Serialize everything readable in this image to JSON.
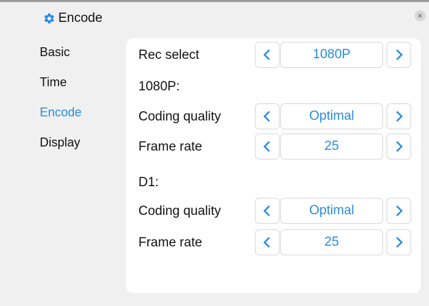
{
  "window": {
    "title": "Encode",
    "title_icon": "gear-icon",
    "close_glyph": "×"
  },
  "sidebar": {
    "items": [
      {
        "label": "Basic",
        "active": false
      },
      {
        "label": "Time",
        "active": false
      },
      {
        "label": "Encode",
        "active": true
      },
      {
        "label": "Display",
        "active": false
      }
    ]
  },
  "encode": {
    "rec_select": {
      "label": "Rec select",
      "value": "1080P"
    },
    "sections": [
      {
        "title": "1080P:",
        "coding_quality": {
          "label": "Coding quality",
          "value": "Optimal"
        },
        "frame_rate": {
          "label": "Frame rate",
          "value": "25"
        }
      },
      {
        "title": "D1:",
        "coding_quality": {
          "label": "Coding quality",
          "value": "Optimal"
        },
        "frame_rate": {
          "label": "Frame rate",
          "value": "25"
        }
      }
    ]
  },
  "colors": {
    "accent": "#2a8be0",
    "panel": "#ffffff",
    "background": "#f0f0f0"
  }
}
